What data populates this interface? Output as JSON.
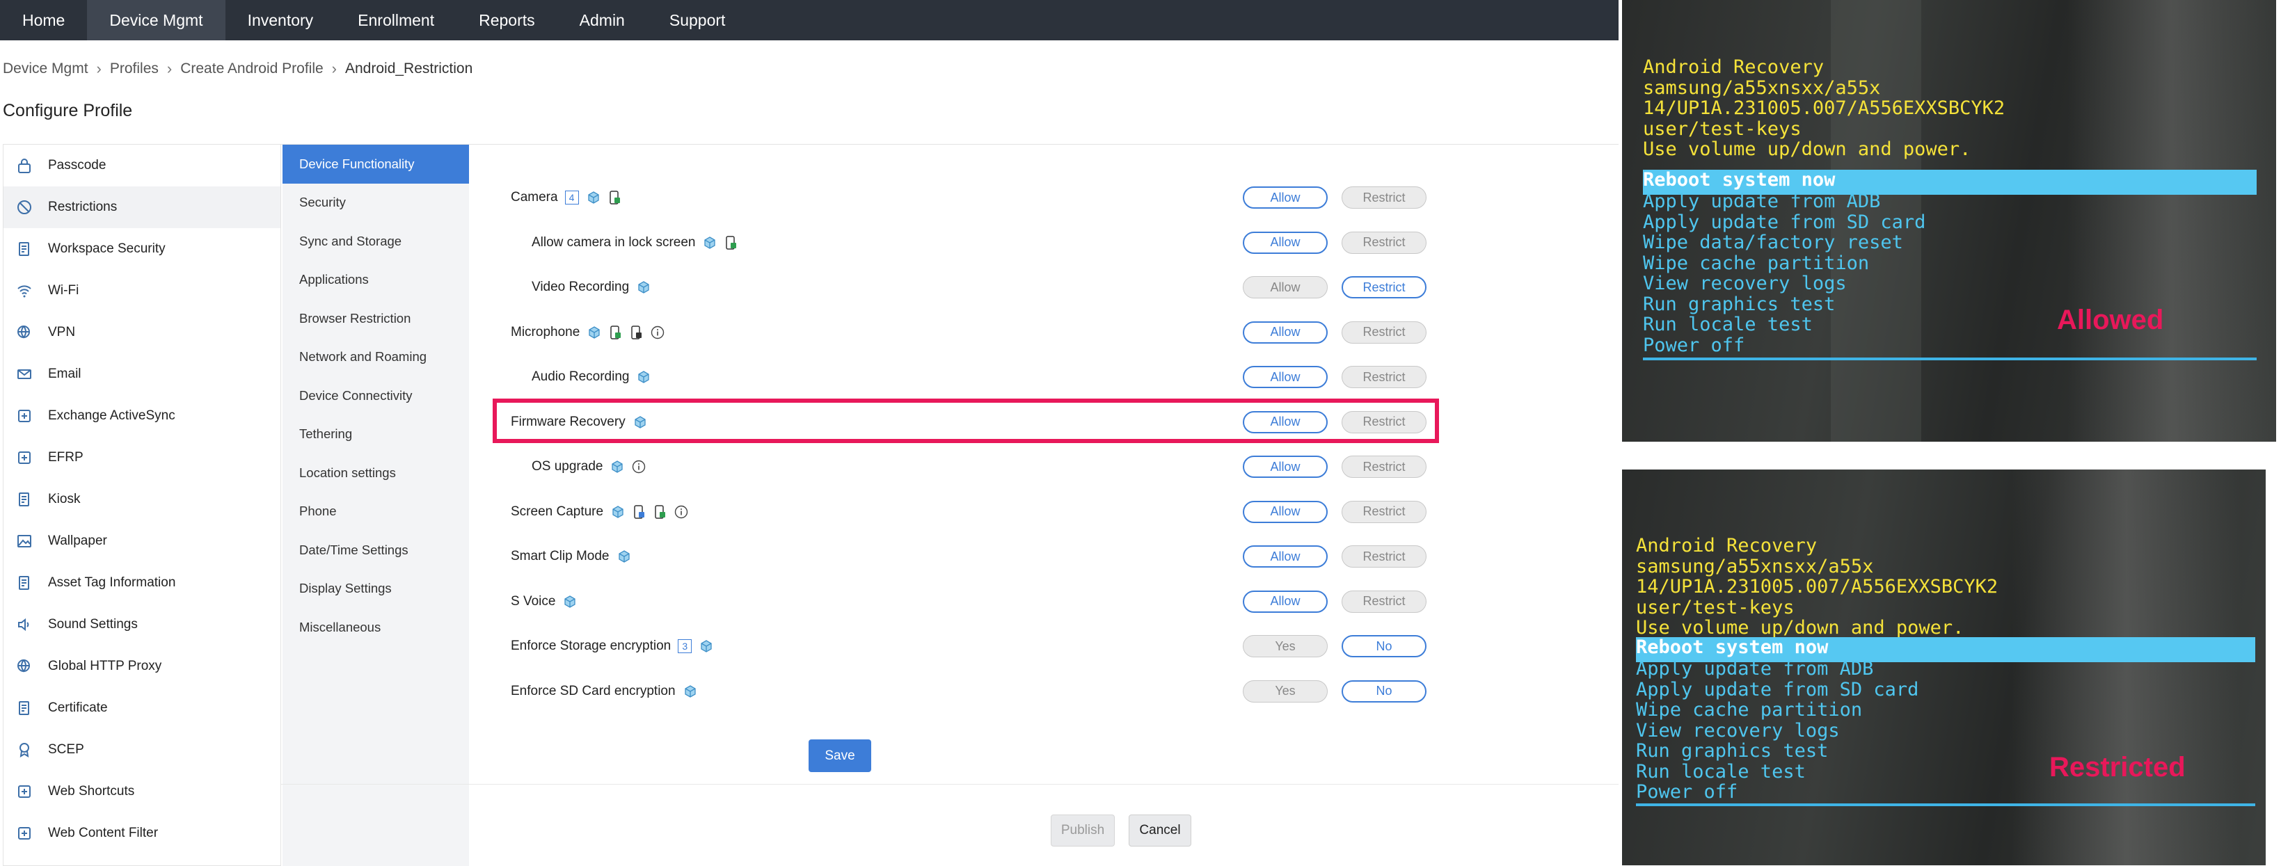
{
  "topnav": [
    "Home",
    "Device Mgmt",
    "Inventory",
    "Enrollment",
    "Reports",
    "Admin",
    "Support"
  ],
  "breadcrumb": {
    "items": [
      "Device Mgmt",
      "Profiles",
      "Create Android Profile"
    ],
    "current": "Android_Restriction"
  },
  "page_title": "Configure Profile",
  "sidebar": [
    {
      "label": "Passcode",
      "icon": "lock-icon"
    },
    {
      "label": "Restrictions",
      "icon": "ban-icon"
    },
    {
      "label": "Workspace Security",
      "icon": "document-shield-icon"
    },
    {
      "label": "Wi-Fi",
      "icon": "wifi-icon"
    },
    {
      "label": "VPN",
      "icon": "globe-lock-icon"
    },
    {
      "label": "Email",
      "icon": "envelope-icon"
    },
    {
      "label": "Exchange ActiveSync",
      "icon": "exchange-icon"
    },
    {
      "label": "EFRP",
      "icon": "reset-icon"
    },
    {
      "label": "Kiosk",
      "icon": "kiosk-icon"
    },
    {
      "label": "Wallpaper",
      "icon": "image-icon"
    },
    {
      "label": "Asset Tag Information",
      "icon": "tag-icon"
    },
    {
      "label": "Sound Settings",
      "icon": "speaker-icon"
    },
    {
      "label": "Global HTTP Proxy",
      "icon": "globe-icon"
    },
    {
      "label": "Certificate",
      "icon": "certificate-icon"
    },
    {
      "label": "SCEP",
      "icon": "badge-icon"
    },
    {
      "label": "Web Shortcuts",
      "icon": "shortcut-icon"
    },
    {
      "label": "Web Content Filter",
      "icon": "filter-icon"
    }
  ],
  "subnav": [
    "Device Functionality",
    "Security",
    "Sync and Storage",
    "Applications",
    "Browser Restriction",
    "Network and Roaming",
    "Device Connectivity",
    "Tethering",
    "Location settings",
    "Phone",
    "Date/Time Settings",
    "Display Settings",
    "Miscellaneous"
  ],
  "restrictions": [
    {
      "label": "Camera",
      "badge": "4",
      "opt1": "Allow",
      "opt2": "Restrict",
      "selected": "Allow",
      "icons": [
        "cube-icon",
        "phone-lock-icon"
      ]
    },
    {
      "label": "Allow camera in lock screen",
      "opt1": "Allow",
      "opt2": "Restrict",
      "selected": "Allow",
      "icons": [
        "cube-icon",
        "phone-lock-icon"
      ]
    },
    {
      "label": "Video Recording",
      "opt1": "Allow",
      "opt2": "Restrict",
      "selected": "Restrict",
      "icons": [
        "cube-icon"
      ]
    },
    {
      "label": "Microphone",
      "opt1": "Allow",
      "opt2": "Restrict",
      "selected": "Allow",
      "icons": [
        "cube-icon",
        "phone-lock-icon",
        "phone-dark-icon",
        "info-icon"
      ]
    },
    {
      "label": "Audio Recording",
      "opt1": "Allow",
      "opt2": "Restrict",
      "selected": "Allow",
      "icons": [
        "cube-icon"
      ]
    },
    {
      "label": "Firmware Recovery",
      "opt1": "Allow",
      "opt2": "Restrict",
      "selected": "Allow",
      "icons": [
        "cube-icon"
      ]
    },
    {
      "label": "OS upgrade",
      "opt1": "Allow",
      "opt2": "Restrict",
      "selected": "Allow",
      "icons": [
        "cube-icon",
        "info-icon"
      ]
    },
    {
      "label": "Screen Capture",
      "opt1": "Allow",
      "opt2": "Restrict",
      "selected": "Allow",
      "icons": [
        "cube-icon",
        "phone-blue-icon",
        "phone-lock-icon",
        "info-icon"
      ]
    },
    {
      "label": "Smart Clip Mode",
      "opt1": "Allow",
      "opt2": "Restrict",
      "selected": "Allow",
      "icons": [
        "cube-icon"
      ]
    },
    {
      "label": "S Voice",
      "opt1": "Allow",
      "opt2": "Restrict",
      "selected": "Allow",
      "icons": [
        "cube-icon"
      ]
    },
    {
      "label": "Enforce Storage encryption",
      "badge": "3",
      "opt1": "Yes",
      "opt2": "No",
      "selected": "No",
      "icons": [
        "cube-icon"
      ]
    },
    {
      "label": "Enforce SD Card encryption",
      "opt1": "Yes",
      "opt2": "No",
      "selected": "No",
      "icons": [
        "cube-icon"
      ]
    }
  ],
  "buttons": {
    "save": "Save",
    "publish": "Publish",
    "cancel": "Cancel"
  },
  "recovery_allowed": {
    "header": [
      "Android Recovery",
      "samsung/a55xnsxx/a55x",
      "14/UP1A.231005.007/A556EXXSBCYK2",
      "user/test-keys",
      "Use volume up/down and power."
    ],
    "selected": "Reboot system now",
    "items": [
      "Apply update from ADB",
      "Apply update from SD card",
      "Wipe data/factory reset",
      "Wipe cache partition",
      "View recovery logs",
      "Run graphics test",
      "Run locale test",
      "Power off"
    ],
    "label": "Allowed"
  },
  "recovery_restricted": {
    "header": [
      "Android Recovery",
      "samsung/a55xnsxx/a55x",
      "14/UP1A.231005.007/A556EXXSBCYK2",
      "user/test-keys",
      "Use volume up/down and power."
    ],
    "selected": "Reboot system now",
    "items": [
      "Apply update from ADB",
      "Apply update from SD card",
      "Wipe cache partition",
      "View recovery logs",
      "Run graphics test",
      "Run locale test",
      "Power off"
    ],
    "label": "Restricted"
  },
  "colors": {
    "accent": "#3d7dd8",
    "highlight": "#e8185a",
    "topbar": "#2c323b"
  }
}
